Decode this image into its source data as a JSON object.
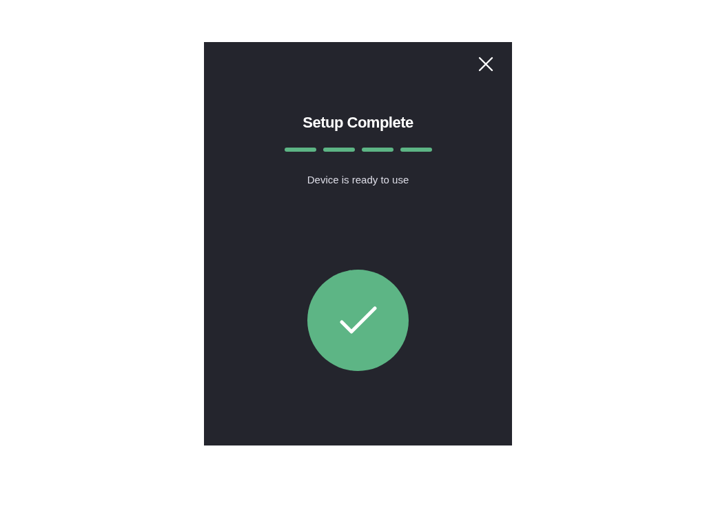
{
  "dialog": {
    "title": "Setup Complete",
    "message": "Device is ready to use",
    "steps": [
      {
        "completed": true
      },
      {
        "completed": true
      },
      {
        "completed": true
      },
      {
        "completed": true
      }
    ],
    "status": {
      "kind": "success"
    }
  }
}
